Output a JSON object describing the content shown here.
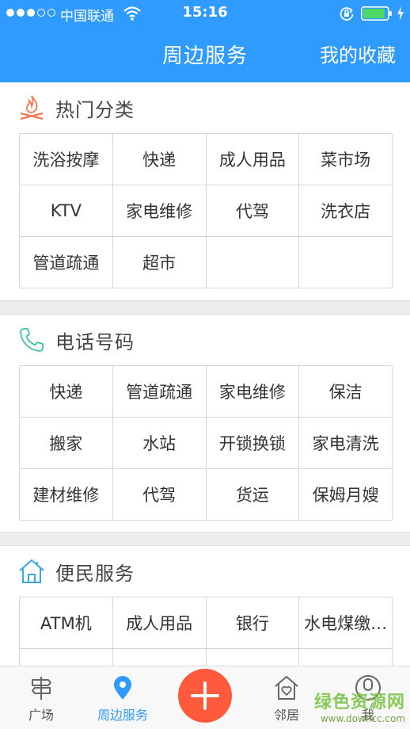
{
  "status_bar": {
    "carrier": "中国联通",
    "time": "15:16"
  },
  "header": {
    "title": "周边服务",
    "favorites": "我的收藏"
  },
  "sections": [
    {
      "title": "热门分类",
      "icon": "campfire-icon",
      "items": [
        "洗浴按摩",
        "快递",
        "成人用品",
        "菜市场",
        "KTV",
        "家电维修",
        "代驾",
        "洗衣店",
        "管道疏通",
        "超市",
        "",
        ""
      ]
    },
    {
      "title": "电话号码",
      "icon": "phone-icon",
      "items": [
        "快递",
        "管道疏通",
        "家电维修",
        "保洁",
        "搬家",
        "水站",
        "开锁换锁",
        "家电清洗",
        "建材维修",
        "代驾",
        "货运",
        "保姆月嫂"
      ]
    },
    {
      "title": "便民服务",
      "icon": "house-icon",
      "items": [
        "ATM机",
        "成人用品",
        "银行",
        "水电煤缴…",
        "",
        "",
        "",
        ""
      ]
    }
  ],
  "tabbar": {
    "tabs": [
      {
        "label": "广场",
        "icon": "signpost-icon"
      },
      {
        "label": "周边服务",
        "icon": "location-pin-icon",
        "active": true
      },
      {
        "label": "邻居",
        "icon": "heart-house-icon"
      },
      {
        "label": "我",
        "icon": "person-icon"
      }
    ],
    "add_icon": "plus-icon"
  },
  "watermark": {
    "main": "绿色资源网",
    "sub": "www.downcc.com"
  },
  "colors": {
    "primary": "#2f9bff",
    "add_button": "#ff5a3c",
    "hot_icon": "#f07a52",
    "phone_icon": "#3ec1a8",
    "house_icon": "#3aa7e8"
  }
}
